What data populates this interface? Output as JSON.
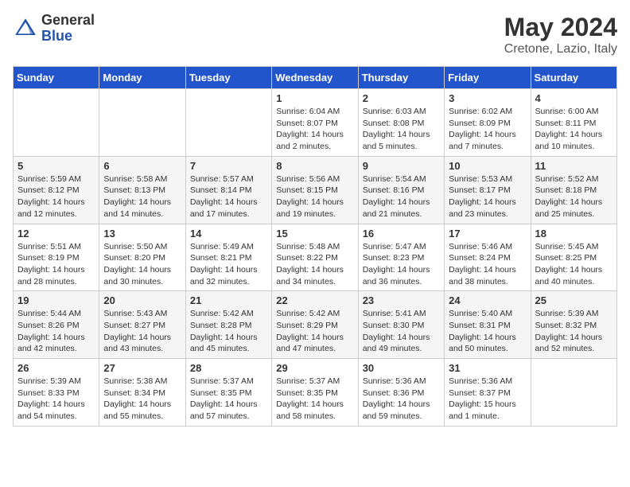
{
  "header": {
    "logo_general": "General",
    "logo_blue": "Blue",
    "month_title": "May 2024",
    "location": "Cretone, Lazio, Italy"
  },
  "days_of_week": [
    "Sunday",
    "Monday",
    "Tuesday",
    "Wednesday",
    "Thursday",
    "Friday",
    "Saturday"
  ],
  "weeks": [
    [
      {
        "day": "",
        "content": ""
      },
      {
        "day": "",
        "content": ""
      },
      {
        "day": "",
        "content": ""
      },
      {
        "day": "1",
        "content": "Sunrise: 6:04 AM\nSunset: 8:07 PM\nDaylight: 14 hours\nand 2 minutes."
      },
      {
        "day": "2",
        "content": "Sunrise: 6:03 AM\nSunset: 8:08 PM\nDaylight: 14 hours\nand 5 minutes."
      },
      {
        "day": "3",
        "content": "Sunrise: 6:02 AM\nSunset: 8:09 PM\nDaylight: 14 hours\nand 7 minutes."
      },
      {
        "day": "4",
        "content": "Sunrise: 6:00 AM\nSunset: 8:11 PM\nDaylight: 14 hours\nand 10 minutes."
      }
    ],
    [
      {
        "day": "5",
        "content": "Sunrise: 5:59 AM\nSunset: 8:12 PM\nDaylight: 14 hours\nand 12 minutes."
      },
      {
        "day": "6",
        "content": "Sunrise: 5:58 AM\nSunset: 8:13 PM\nDaylight: 14 hours\nand 14 minutes."
      },
      {
        "day": "7",
        "content": "Sunrise: 5:57 AM\nSunset: 8:14 PM\nDaylight: 14 hours\nand 17 minutes."
      },
      {
        "day": "8",
        "content": "Sunrise: 5:56 AM\nSunset: 8:15 PM\nDaylight: 14 hours\nand 19 minutes."
      },
      {
        "day": "9",
        "content": "Sunrise: 5:54 AM\nSunset: 8:16 PM\nDaylight: 14 hours\nand 21 minutes."
      },
      {
        "day": "10",
        "content": "Sunrise: 5:53 AM\nSunset: 8:17 PM\nDaylight: 14 hours\nand 23 minutes."
      },
      {
        "day": "11",
        "content": "Sunrise: 5:52 AM\nSunset: 8:18 PM\nDaylight: 14 hours\nand 25 minutes."
      }
    ],
    [
      {
        "day": "12",
        "content": "Sunrise: 5:51 AM\nSunset: 8:19 PM\nDaylight: 14 hours\nand 28 minutes."
      },
      {
        "day": "13",
        "content": "Sunrise: 5:50 AM\nSunset: 8:20 PM\nDaylight: 14 hours\nand 30 minutes."
      },
      {
        "day": "14",
        "content": "Sunrise: 5:49 AM\nSunset: 8:21 PM\nDaylight: 14 hours\nand 32 minutes."
      },
      {
        "day": "15",
        "content": "Sunrise: 5:48 AM\nSunset: 8:22 PM\nDaylight: 14 hours\nand 34 minutes."
      },
      {
        "day": "16",
        "content": "Sunrise: 5:47 AM\nSunset: 8:23 PM\nDaylight: 14 hours\nand 36 minutes."
      },
      {
        "day": "17",
        "content": "Sunrise: 5:46 AM\nSunset: 8:24 PM\nDaylight: 14 hours\nand 38 minutes."
      },
      {
        "day": "18",
        "content": "Sunrise: 5:45 AM\nSunset: 8:25 PM\nDaylight: 14 hours\nand 40 minutes."
      }
    ],
    [
      {
        "day": "19",
        "content": "Sunrise: 5:44 AM\nSunset: 8:26 PM\nDaylight: 14 hours\nand 42 minutes."
      },
      {
        "day": "20",
        "content": "Sunrise: 5:43 AM\nSunset: 8:27 PM\nDaylight: 14 hours\nand 43 minutes."
      },
      {
        "day": "21",
        "content": "Sunrise: 5:42 AM\nSunset: 8:28 PM\nDaylight: 14 hours\nand 45 minutes."
      },
      {
        "day": "22",
        "content": "Sunrise: 5:42 AM\nSunset: 8:29 PM\nDaylight: 14 hours\nand 47 minutes."
      },
      {
        "day": "23",
        "content": "Sunrise: 5:41 AM\nSunset: 8:30 PM\nDaylight: 14 hours\nand 49 minutes."
      },
      {
        "day": "24",
        "content": "Sunrise: 5:40 AM\nSunset: 8:31 PM\nDaylight: 14 hours\nand 50 minutes."
      },
      {
        "day": "25",
        "content": "Sunrise: 5:39 AM\nSunset: 8:32 PM\nDaylight: 14 hours\nand 52 minutes."
      }
    ],
    [
      {
        "day": "26",
        "content": "Sunrise: 5:39 AM\nSunset: 8:33 PM\nDaylight: 14 hours\nand 54 minutes."
      },
      {
        "day": "27",
        "content": "Sunrise: 5:38 AM\nSunset: 8:34 PM\nDaylight: 14 hours\nand 55 minutes."
      },
      {
        "day": "28",
        "content": "Sunrise: 5:37 AM\nSunset: 8:35 PM\nDaylight: 14 hours\nand 57 minutes."
      },
      {
        "day": "29",
        "content": "Sunrise: 5:37 AM\nSunset: 8:35 PM\nDaylight: 14 hours\nand 58 minutes."
      },
      {
        "day": "30",
        "content": "Sunrise: 5:36 AM\nSunset: 8:36 PM\nDaylight: 14 hours\nand 59 minutes."
      },
      {
        "day": "31",
        "content": "Sunrise: 5:36 AM\nSunset: 8:37 PM\nDaylight: 15 hours\nand 1 minute."
      },
      {
        "day": "",
        "content": ""
      }
    ]
  ]
}
